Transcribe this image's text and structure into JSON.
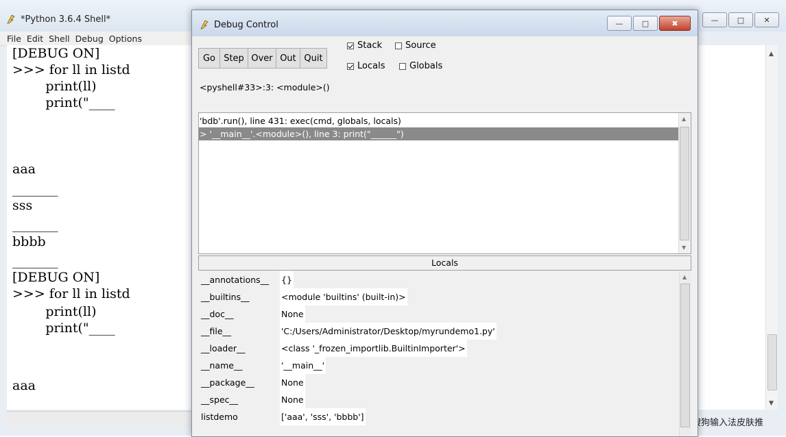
{
  "shell": {
    "title": "*Python 3.6.4 Shell*",
    "menu": [
      "File",
      "Edit",
      "Shell",
      "Debug",
      "Options"
    ],
    "lines": [
      "[DEBUG ON]",
      ">>> for ll in listd",
      "        print(ll)",
      "        print(\"____",
      "",
      "aaa",
      "_______",
      "sss",
      "_______",
      "bbbb",
      "_______",
      "[DEBUG ON]",
      ">>> for ll in listd",
      "        print(ll)",
      "        print(\"____",
      "",
      "aaa"
    ],
    "ime_text": "搜狗输入法皮肤推"
  },
  "debug": {
    "title": "Debug Control",
    "buttons": [
      "Go",
      "Step",
      "Over",
      "Out",
      "Quit"
    ],
    "checks": [
      {
        "label": "Stack",
        "checked": true
      },
      {
        "label": "Source",
        "checked": false
      },
      {
        "label": "Locals",
        "checked": true
      },
      {
        "label": "Globals",
        "checked": false
      }
    ],
    "status": "<pyshell#33>:3: <module>()",
    "stack": [
      {
        "text": "'bdb'.run(), line 431: exec(cmd, globals, locals)",
        "selected": false
      },
      {
        "text": "> '__main__'.<module>(), line 3: print(\"______\")",
        "selected": true
      }
    ],
    "locals_header": "Locals",
    "locals": [
      {
        "name": "__annotations__",
        "value": "{}"
      },
      {
        "name": "__builtins__",
        "value": "<module 'builtins' (built-in)>"
      },
      {
        "name": "__doc__",
        "value": "None"
      },
      {
        "name": "__file__",
        "value": "'C:/Users/Administrator/Desktop/myrundemo1.py'"
      },
      {
        "name": "__loader__",
        "value": "<class '_frozen_importlib.BuiltinImporter'>"
      },
      {
        "name": "__name__",
        "value": "'__main__'"
      },
      {
        "name": "__package__",
        "value": "None"
      },
      {
        "name": "__spec__",
        "value": "None"
      },
      {
        "name": "listdemo",
        "value": "['aaa', 'sss', 'bbbb']"
      }
    ]
  }
}
